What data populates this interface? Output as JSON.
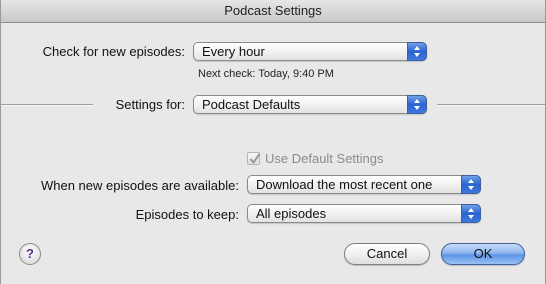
{
  "window": {
    "title": "Podcast Settings"
  },
  "check": {
    "label": "Check for new episodes:",
    "value": "Every hour",
    "next_check": "Next check: Today, 9:40 PM"
  },
  "settings_for": {
    "label": "Settings for:",
    "value": "Podcast Defaults"
  },
  "use_default": {
    "label": "Use Default Settings",
    "checked": true,
    "enabled": false
  },
  "when_new": {
    "label": "When new episodes are available:",
    "value": "Download the most recent one"
  },
  "keep": {
    "label": "Episodes to keep:",
    "value": "All episodes"
  },
  "buttons": {
    "help": "?",
    "cancel": "Cancel",
    "ok": "OK"
  },
  "colors": {
    "accent": "#3a72dc",
    "help_glyph": "#5a2a9a"
  }
}
